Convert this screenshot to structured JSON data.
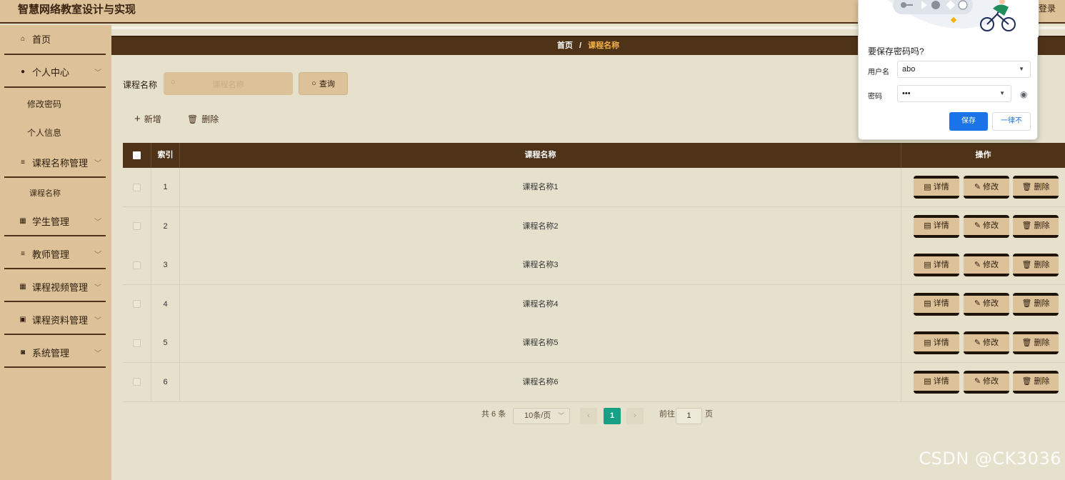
{
  "header": {
    "app_title": "智慧网络教室设计与实现",
    "login_label": "登录"
  },
  "sidebar": {
    "home": "首页",
    "personal_center": "个人中心",
    "change_password": "修改密码",
    "personal_info": "个人信息",
    "course_name_mgmt": "课程名称管理",
    "course_name": "课程名称",
    "student_mgmt": "学生管理",
    "teacher_mgmt": "教师管理",
    "course_video_mgmt": "课程视频管理",
    "course_material_mgmt": "课程资料管理",
    "system_mgmt": "系统管理"
  },
  "breadcrumb": {
    "home": "首页",
    "separator": "/",
    "current": "课程名称"
  },
  "search": {
    "label": "课程名称",
    "placeholder": "课程名称",
    "query_button": "查询"
  },
  "toolbar": {
    "add": "新增",
    "delete": "删除"
  },
  "table": {
    "headers": {
      "index": "索引",
      "course_name": "课程名称",
      "actions": "操作"
    },
    "rows": [
      {
        "index": "1",
        "course_name": "课程名称1"
      },
      {
        "index": "2",
        "course_name": "课程名称2"
      },
      {
        "index": "3",
        "course_name": "课程名称3"
      },
      {
        "index": "4",
        "course_name": "课程名称4"
      },
      {
        "index": "5",
        "course_name": "课程名称5"
      },
      {
        "index": "6",
        "course_name": "课程名称6"
      }
    ],
    "actions": {
      "detail": "详情",
      "edit": "修改",
      "delete": "删除"
    }
  },
  "pagination": {
    "total": "共 6 条",
    "page_size": "10条/页",
    "current_page": "1",
    "goto_label": "前往",
    "goto_value": "1",
    "page_suffix": "页"
  },
  "password_dialog": {
    "title": "要保存密码吗?",
    "username_label": "用户名",
    "username_value": "abo",
    "password_label": "密码",
    "password_value": "•••",
    "save_button": "保存",
    "never_button": "一律不"
  },
  "watermark": "CSDN @CK3036",
  "colors": {
    "accent_dark_brown": "#4e3318",
    "tan": "#dcc199",
    "background": "#e6e1cd",
    "breadcrumb_current": "#f3b248",
    "pager_active": "#17a086",
    "dialog_primary": "#1a73e8"
  },
  "icons": {
    "home": "home-icon",
    "user": "user-icon",
    "list": "list-icon",
    "grid": "grid-icon",
    "ticket": "ticket-icon",
    "clipboard": "clipboard-icon",
    "search": "search-icon",
    "plus": "plus-icon",
    "trash": "trash-icon",
    "document": "document-icon",
    "pencil": "pencil-icon",
    "eye": "eye-icon",
    "key": "key-icon"
  }
}
